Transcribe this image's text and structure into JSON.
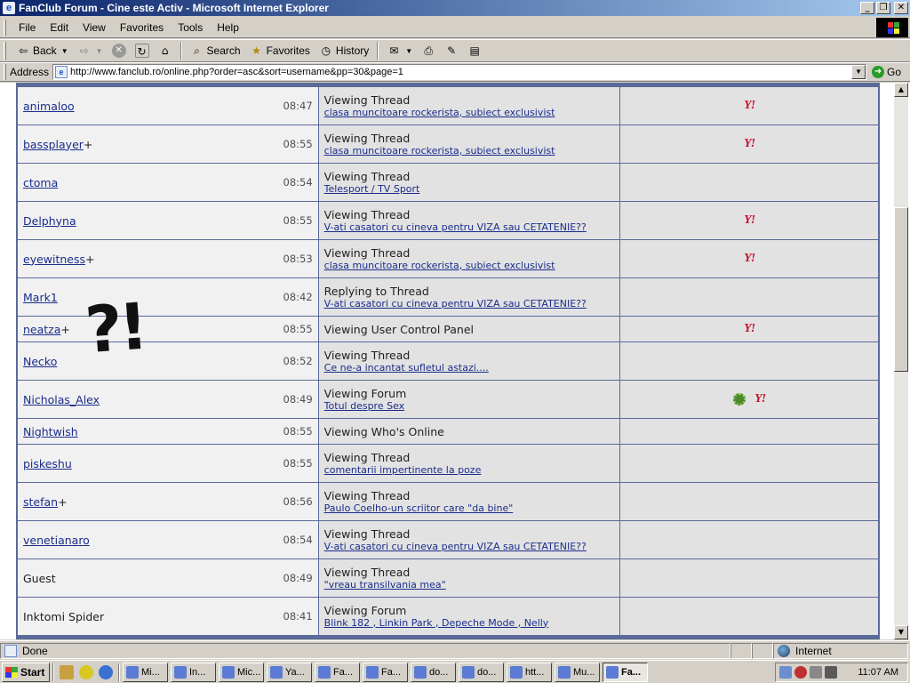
{
  "window": {
    "title": "FanClub Forum - Cine este Activ - Microsoft Internet Explorer"
  },
  "menu": [
    "File",
    "Edit",
    "View",
    "Favorites",
    "Tools",
    "Help"
  ],
  "toolbar": {
    "back": "Back",
    "search": "Search",
    "favorites": "Favorites",
    "history": "History"
  },
  "address": {
    "label": "Address",
    "url": "http://www.fanclub.ro/online.php?order=asc&sort=username&pp=30&page=1",
    "go": "Go"
  },
  "rows": [
    {
      "user": "animaloo",
      "plus": "",
      "time": "08:47",
      "action": "Viewing Thread",
      "location": "clasa muncitoare rockerista, subiect exclusivist",
      "yahoo": "Y!",
      "icq": false,
      "guest": false
    },
    {
      "user": "bassplayer",
      "plus": "+",
      "time": "08:55",
      "action": "Viewing Thread",
      "location": "clasa muncitoare rockerista, subiect exclusivist",
      "yahoo": "Y!",
      "icq": false,
      "guest": false
    },
    {
      "user": "ctoma",
      "plus": "",
      "time": "08:54",
      "action": "Viewing Thread",
      "location": "Telesport / TV Sport",
      "yahoo": "",
      "icq": false,
      "guest": false
    },
    {
      "user": "Delphyna",
      "plus": "",
      "time": "08:55",
      "action": "Viewing Thread",
      "location": "V-ati casatori cu cineva pentru VIZA sau CETATENIE??",
      "yahoo": "Y!",
      "icq": false,
      "guest": false
    },
    {
      "user": "eyewitness",
      "plus": "+",
      "time": "08:53",
      "action": "Viewing Thread",
      "location": "clasa muncitoare rockerista, subiect exclusivist",
      "yahoo": "Y!",
      "icq": false,
      "guest": false
    },
    {
      "user": "Mark1",
      "plus": "",
      "time": "08:42",
      "action": "Replying to Thread",
      "location": "V-ati casatori cu cineva pentru VIZA sau CETATENIE??",
      "yahoo": "",
      "icq": false,
      "guest": false
    },
    {
      "user": "neatza",
      "plus": "+",
      "time": "08:55",
      "action": "Viewing User Control Panel",
      "location": "",
      "yahoo": "Y!",
      "icq": false,
      "guest": false
    },
    {
      "user": "Necko",
      "plus": "",
      "time": "08:52",
      "action": "Viewing Thread",
      "location": "Ce ne-a incantat sufletul astazi....",
      "yahoo": "",
      "icq": false,
      "guest": false
    },
    {
      "user": "Nicholas_Alex",
      "plus": "",
      "time": "08:49",
      "action": "Viewing Forum",
      "location": "Totul despre Sex",
      "yahoo": "Y!",
      "icq": true,
      "guest": false
    },
    {
      "user": "Nightwish",
      "plus": "",
      "time": "08:55",
      "action": "Viewing Who's Online",
      "location": "",
      "yahoo": "",
      "icq": false,
      "guest": false
    },
    {
      "user": "piskeshu",
      "plus": "",
      "time": "08:55",
      "action": "Viewing Thread",
      "location": "comentarii impertinente la poze",
      "yahoo": "",
      "icq": false,
      "guest": false
    },
    {
      "user": "stefan",
      "plus": "+",
      "time": "08:56",
      "action": "Viewing Thread",
      "location": "Paulo Coelho-un scriitor care \"da bine\"",
      "yahoo": "",
      "icq": false,
      "guest": false
    },
    {
      "user": "venetianaro",
      "plus": "",
      "time": "08:54",
      "action": "Viewing Thread",
      "location": "V-ati casatori cu cineva pentru VIZA sau CETATENIE??",
      "yahoo": "",
      "icq": false,
      "guest": false
    },
    {
      "user": "Guest",
      "plus": "",
      "time": "08:49",
      "action": "Viewing Thread",
      "location": "\"vreau transilvania mea\"",
      "yahoo": "",
      "icq": false,
      "guest": true
    },
    {
      "user": "Inktomi Spider",
      "plus": "",
      "time": "08:41",
      "action": "Viewing Forum",
      "location": "Blink 182 , Linkin Park , Depeche Mode , Nelly",
      "yahoo": "",
      "icq": false,
      "guest": true
    }
  ],
  "overlay_scribble": "?!",
  "status": {
    "text": "Done",
    "zone": "Internet"
  },
  "taskbar": {
    "start": "Start",
    "tasks": [
      "Mi...",
      "In...",
      "Mic...",
      "Ya...",
      "Fa...",
      "Fa...",
      "do...",
      "do...",
      "htt...",
      "Mu...",
      "Fa..."
    ],
    "clock": "11:07 AM"
  },
  "colors": {
    "link": "#1a2d8c",
    "table_border": "#5a6a99",
    "yahoo": "#c8102e"
  }
}
